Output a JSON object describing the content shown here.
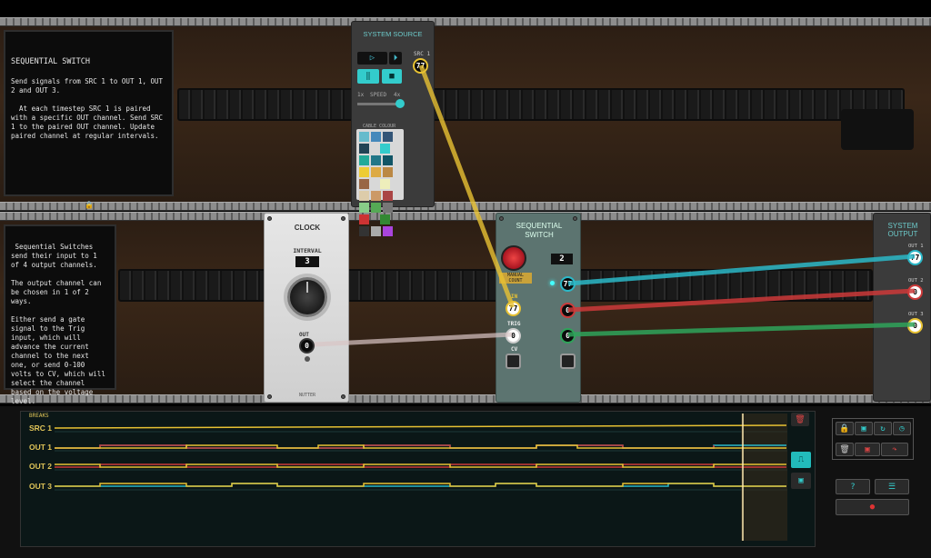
{
  "notes": {
    "top_title": "SEQUENTIAL SWITCH",
    "top_body": "Send signals from SRC 1 to OUT 1, OUT 2 and OUT 3.\n\n  At each timestep SRC 1 is paired with a specific OUT channel. Send SRC 1 to the paired OUT channel. Update paired channel at regular intervals.",
    "mid_body": "Sequential Switches send their input to 1 of 4 output channels.\n\nThe output channel can be chosen in 1 of 2 ways.\n\nEither send a gate signal to the Trig input, which will advance the current channel to the next one, or send 0-100 volts to CV, which will select the channel based on the voltage level."
  },
  "system_source": {
    "title": "SYSTEM SOURCE",
    "src_label": "SRC 1",
    "src_value": "77",
    "speed_label": "SPEED",
    "speed_min": "1x",
    "speed_max": "4x",
    "cable_colour_label": "CABLE COLOUR"
  },
  "clock": {
    "title": "CLOCK",
    "interval_label": "INTERVAL",
    "interval_value": "3",
    "out_label": "OUT",
    "out_value": "0",
    "brand": "NUTTER"
  },
  "switch": {
    "title_1": "SEQUENTIAL",
    "title_2": "SWITCH",
    "channel_value": "2",
    "reset_label": "MANUAL COUNT",
    "in_label": "IN",
    "in_value": "77",
    "trig_label": "TRIG",
    "trig_value": "0",
    "cv_label": "CV",
    "out_values": [
      "77",
      "0",
      "0"
    ]
  },
  "system_output": {
    "title_1": "SYSTEM",
    "title_2": "OUTPUT",
    "outs": [
      {
        "label": "OUT 1",
        "value": "77"
      },
      {
        "label": "OUT 2",
        "value": "0"
      },
      {
        "label": "OUT 3",
        "value": "0"
      }
    ]
  },
  "timeline": {
    "breaks_label": "BREAKS",
    "rows": [
      "SRC 1",
      "OUT 1",
      "OUT 2",
      "OUT 3"
    ]
  },
  "colors": {
    "yellow": "#e8c233",
    "cyan": "#2bb8c8",
    "red": "#cc3a3a",
    "green": "#2fa35a",
    "panel_teal": "#5c7470"
  }
}
